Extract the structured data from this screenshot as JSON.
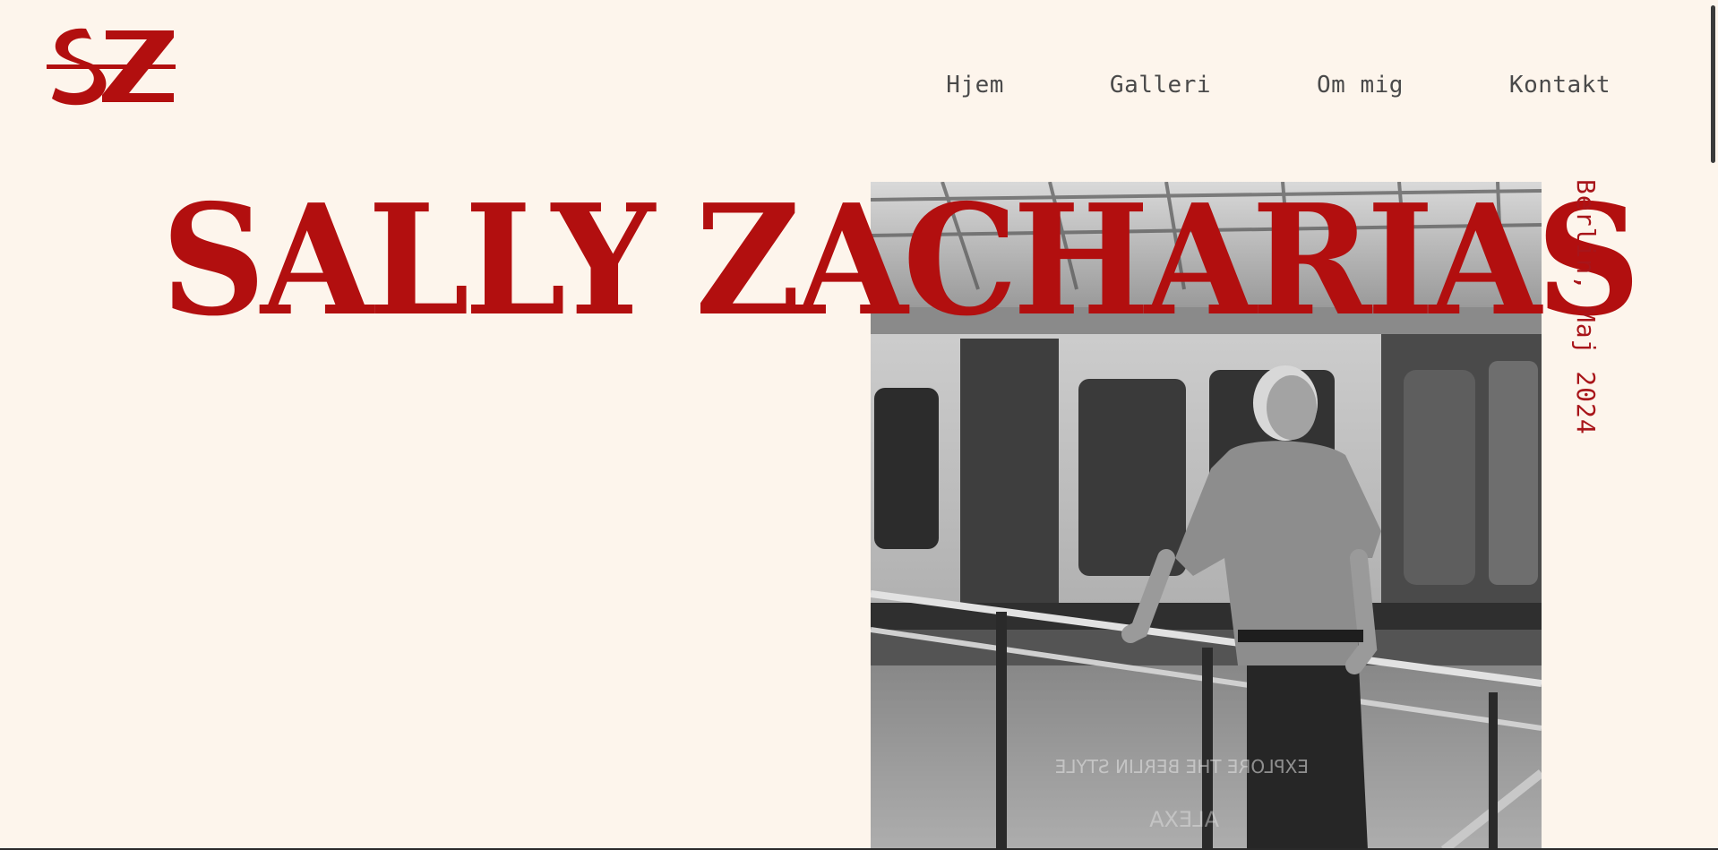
{
  "brand": {
    "logo_text": "SZ",
    "accent_color": "#b20f0f"
  },
  "nav": {
    "items": [
      {
        "label": "Hjem"
      },
      {
        "label": "Galleri"
      },
      {
        "label": "Om mig"
      },
      {
        "label": "Kontakt"
      }
    ]
  },
  "hero": {
    "title": "SALLY ZACHARIAS",
    "side_caption": "Berlin, Maj 2024",
    "photo_text": "EXPLORE THE BERLIN STYLE",
    "photo_sign": "ALEXA"
  },
  "colors": {
    "background": "#fdf5ec",
    "nav_text": "#4a4a4a",
    "caption": "#a8151a"
  }
}
